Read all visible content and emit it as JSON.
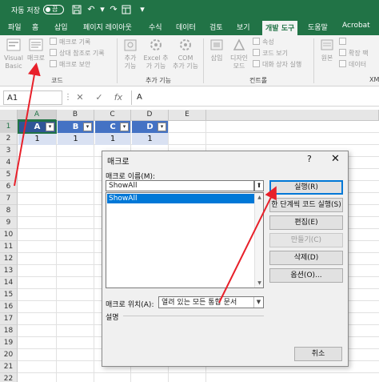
{
  "titlebar": {
    "autosave_label": "자동 저장",
    "autosave_state": "끔",
    "icons": [
      "save-icon",
      "undo-icon",
      "redo-icon",
      "customize-icon"
    ]
  },
  "tabs": [
    {
      "label": "파일"
    },
    {
      "label": "홈"
    },
    {
      "label": "삽입"
    },
    {
      "label": "페이지 레이아웃"
    },
    {
      "label": "수식"
    },
    {
      "label": "데이터"
    },
    {
      "label": "검토"
    },
    {
      "label": "보기"
    },
    {
      "label": "개발 도구",
      "active": true
    },
    {
      "label": "도움말"
    },
    {
      "label": "Acrobat"
    }
  ],
  "ribbon": {
    "code": {
      "visual_basic": "Visual\nBasic",
      "macro": "매크로",
      "record_macro": "매크로 기록",
      "relative_ref": "상대 참조로 기록",
      "macro_security": "매크로 보안",
      "group_label": "코드"
    },
    "addins": {
      "addins": "추가\n기능",
      "excel_addins": "Excel 추\n가 기능",
      "com_addins": "COM\n추가 기능",
      "group_label": "추가 기능"
    },
    "controls": {
      "insert": "삽입",
      "design_mode": "디자인\n모드",
      "properties": "속성",
      "view_code": "코드 보기",
      "run_dialog": "대화 상자 실행",
      "group_label": "컨트롤"
    },
    "xml": {
      "source": "원본",
      "expansion_pack": "확장 팩",
      "refresh_data": "데이터",
      "group_label": "XM"
    }
  },
  "formula_bar": {
    "name_box": "A1",
    "cancel": "✕",
    "enter": "✓",
    "fx": "fx",
    "content": "A"
  },
  "sheet": {
    "columns": [
      "A",
      "B",
      "C",
      "D",
      "E"
    ],
    "rows": [
      "1",
      "2",
      "3",
      "4",
      "5",
      "6",
      "7",
      "8",
      "9",
      "10",
      "11",
      "12",
      "13",
      "14",
      "15",
      "16",
      "17",
      "18",
      "19",
      "20",
      "21",
      "22"
    ],
    "header_row": [
      "A",
      "B",
      "C",
      "D"
    ],
    "data_row": [
      "1",
      "1",
      "1",
      "1"
    ]
  },
  "dialog": {
    "title": "매크로",
    "help": "?",
    "close": "✕",
    "macro_name_label": "매크로 이름(M):",
    "macro_name_value": "ShowAll",
    "macro_list": [
      "ShowAll"
    ],
    "location_label": "매크로 위치(A):",
    "location_value": "열려 있는 모든 통합 문서",
    "description_label": "설명",
    "buttons": {
      "run": "실행(R)",
      "step_into": "한 단계씩 코드 실행(S)",
      "edit": "편집(E)",
      "create": "만들기(C)",
      "delete": "삭제(D)",
      "options": "옵션(O)...",
      "cancel": "취소"
    }
  },
  "colors": {
    "excel_green": "#217346",
    "table_header": "#4472c4",
    "table_band": "#d9e1f2",
    "arrow_red": "#e8202a",
    "selection_blue": "#0078d7"
  }
}
